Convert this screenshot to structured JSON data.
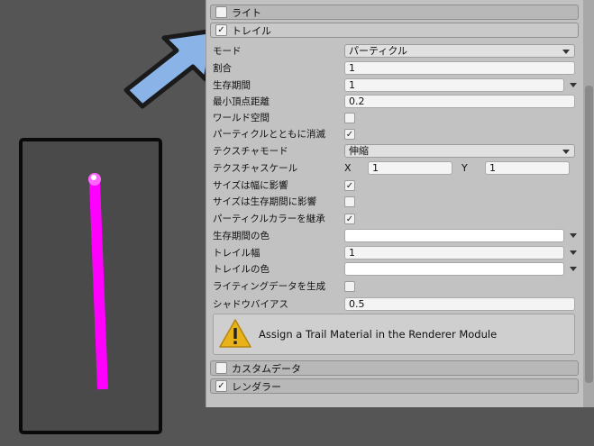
{
  "inspector": {
    "modules_top": [
      {
        "label": "ライト",
        "checked": false
      },
      {
        "label": "トレイル",
        "checked": true
      }
    ],
    "trail_props": [
      {
        "label": "モード",
        "type": "dropdown",
        "value": "パーティクル"
      },
      {
        "label": "割合",
        "type": "field",
        "value": "1"
      },
      {
        "label": "生存期間",
        "type": "field-arrow",
        "value": "1"
      },
      {
        "label": "最小頂点距離",
        "type": "field",
        "value": "0.2"
      },
      {
        "label": "ワールド空間",
        "type": "checkbox",
        "checked": false
      },
      {
        "label": "パーティクルとともに消滅",
        "type": "checkbox",
        "checked": true
      },
      {
        "label": "テクスチャモード",
        "type": "dropdown",
        "value": "伸縮"
      },
      {
        "label": "テクスチャスケール",
        "type": "xy",
        "x_label": "X",
        "x": "1",
        "y_label": "Y",
        "y": "1"
      },
      {
        "label": "サイズは幅に影響",
        "type": "checkbox",
        "checked": true
      },
      {
        "label": "サイズは生存期間に影響",
        "type": "checkbox",
        "checked": false
      },
      {
        "label": "パーティクルカラーを継承",
        "type": "checkbox",
        "checked": true
      },
      {
        "label": "生存期間の色",
        "type": "color-arrow",
        "value": ""
      },
      {
        "label": "トレイル幅",
        "type": "field-arrow",
        "value": "1"
      },
      {
        "label": "トレイルの色",
        "type": "color-arrow",
        "value": ""
      },
      {
        "label": "ライティングデータを生成",
        "type": "checkbox",
        "checked": false
      },
      {
        "label": "シャドウバイアス",
        "type": "field",
        "value": "0.5"
      }
    ],
    "help_message": "Assign a Trail Material in the Renderer Module",
    "modules_bottom": [
      {
        "label": "カスタムデータ",
        "checked": false
      },
      {
        "label": "レンダラー",
        "checked": true
      }
    ],
    "check_mark": "✓"
  },
  "colors": {
    "trail": "#ff00ff",
    "arrow_fill": "#8ab4e8",
    "warning_yellow": "#e8b21a"
  }
}
